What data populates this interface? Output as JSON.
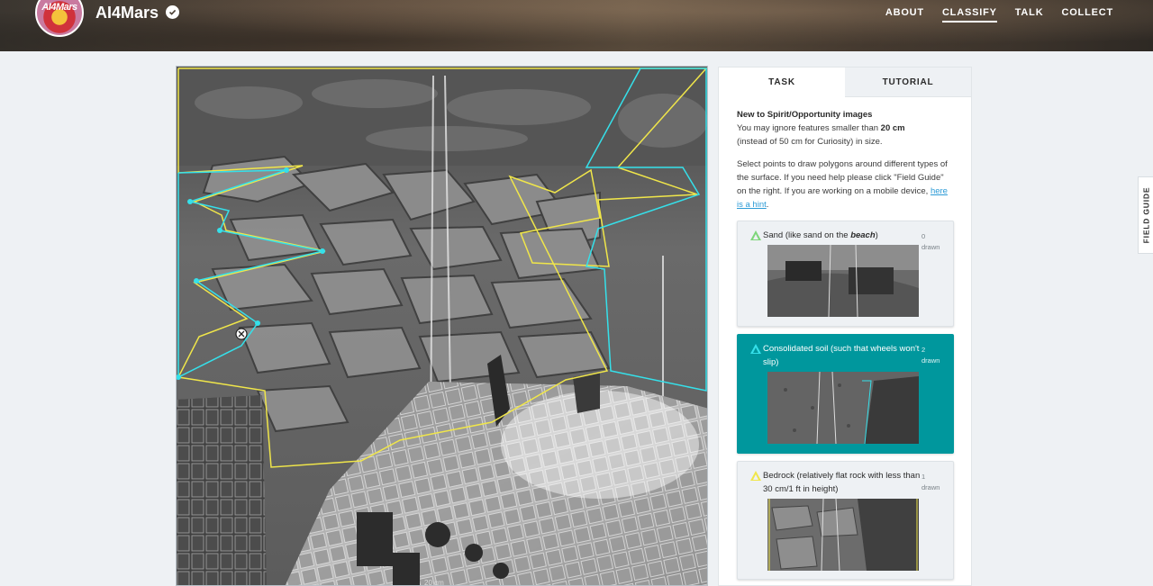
{
  "header": {
    "logo_text": "AI4Mars",
    "project_title": "AI4Mars",
    "verified_icon": "check-circle-icon",
    "nav": [
      "ABOUT",
      "CLASSIFY",
      "TALK",
      "COLLECT"
    ],
    "active_nav": "CLASSIFY"
  },
  "viewer": {
    "scale_label": "20 cm",
    "delete_icon": "close-circle-icon"
  },
  "tabs": {
    "task": "TASK",
    "tutorial": "TUTORIAL"
  },
  "task": {
    "heading": "New to Spirit/Opportunity images",
    "line1_prefix": "You may ignore features smaller than ",
    "line1_bold": "20 cm",
    "line2": "(instead of 50 cm for Curiosity) in size.",
    "instructions": "Select points to draw polygons around different types of the surface. If you need help please click \"Field Guide\" on the right. If you are working on a mobile device, ",
    "hint_link": "here is a hint",
    "instructions_end": "."
  },
  "tools": [
    {
      "label_prefix": "Sand (like sand on the ",
      "label_emph": "beach",
      "label_suffix": ")",
      "count": "0",
      "count_unit": "drawn",
      "color": "#7ed67a",
      "selected": false
    },
    {
      "label_prefix": "Consolidated soil (such that wheels won't slip)",
      "label_emph": "",
      "label_suffix": "",
      "count": "2",
      "count_unit": "drawn",
      "color": "#35e0ea",
      "selected": true
    },
    {
      "label_prefix": "Bedrock (relatively flat rock with less than 30 cm/1 ft in height)",
      "label_emph": "",
      "label_suffix": "",
      "count": "1",
      "count_unit": "drawn",
      "color": "#f0e64a",
      "selected": false
    }
  ],
  "field_guide": "FIELD GUIDE",
  "colors": {
    "accent": "#00979d",
    "bedrock_outline": "#f0e64a",
    "soil_outline": "#35e0ea",
    "link": "#2d9bd6"
  }
}
